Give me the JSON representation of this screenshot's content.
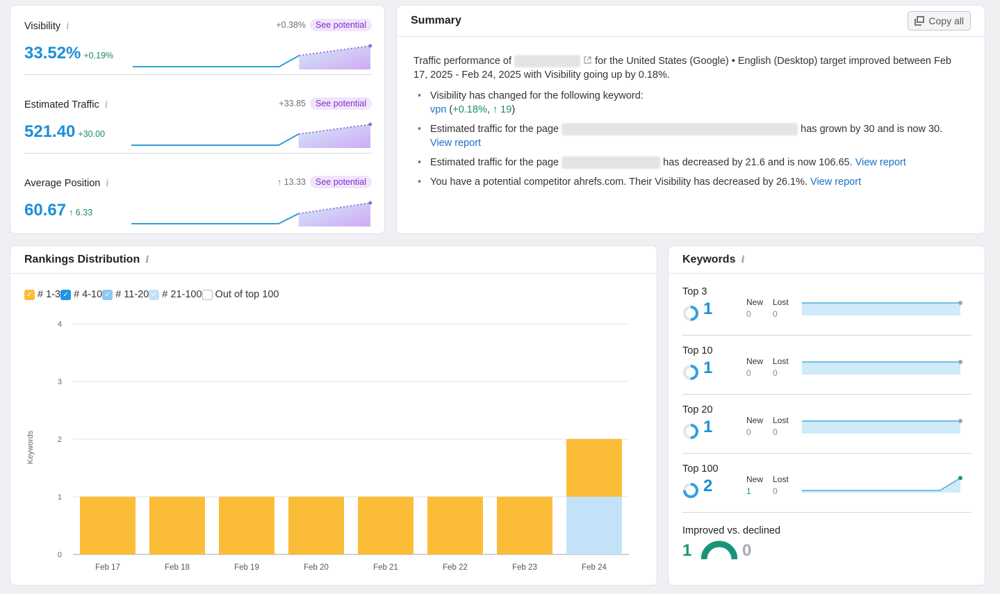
{
  "metrics": [
    {
      "label": "Visibility",
      "value": "33.52%",
      "delta": "+0.19%",
      "potential_delta": "+0.38%",
      "potential_button": "See potential",
      "trend": [
        0,
        0,
        0,
        0,
        0,
        0,
        0,
        1
      ],
      "potential_target": 2
    },
    {
      "label": "Estimated Traffic",
      "value": "521.40",
      "delta": "+30.00",
      "potential_delta": "+33.85",
      "potential_button": "See potential",
      "trend": [
        0,
        0,
        0,
        0,
        0,
        0,
        0,
        1
      ],
      "potential_target": 2
    },
    {
      "label": "Average Position",
      "value": "60.67",
      "delta": "↑ 6.33",
      "potential_delta": "↑ 13.33",
      "potential_button": "See potential",
      "trend": [
        0,
        0,
        0,
        0,
        0,
        0,
        0,
        1
      ],
      "potential_target": 2.2
    }
  ],
  "summary": {
    "title": "Summary",
    "copy_all": "Copy all",
    "intro_prefix": "Traffic performance of",
    "intro_suffix": "for the United States (Google) • English (Desktop) target improved between Feb 17, 2025 - Feb 24, 2025 with Visibility going up by 0.18%.",
    "bullets": {
      "b1_text": "Visibility has changed for the following keyword:",
      "b1_keyword": "vpn",
      "b1_paren_open": " (",
      "b1_change": "+0.18%",
      "b1_comma": ", ",
      "b1_rank": "↑ 19",
      "b1_paren_close": ")",
      "b2_prefix": "Estimated traffic for the page",
      "b2_suffix": "has grown by 30 and is now 30.",
      "b2_link": "View report",
      "b3_prefix": "Estimated traffic for the page",
      "b3_suffix": "has decreased by 21.6 and is now 106.65.",
      "b3_link": "View report",
      "b4_text": "You have a potential competitor ahrefs.com. Their Visibility has decreased by 26.1%.",
      "b4_link": "View report"
    }
  },
  "rankings": {
    "title": "Rankings Distribution",
    "legend": [
      {
        "label": "# 1-3",
        "color": "#fbbd38",
        "checked": true
      },
      {
        "label": "# 4-10",
        "color": "#2196e0",
        "checked": true
      },
      {
        "label": "# 11-20",
        "color": "#8cc9f2",
        "checked": true
      },
      {
        "label": "# 21-100",
        "color": "#c3e2f8",
        "checked": true
      },
      {
        "label": "Out of top 100",
        "color": "#ffffff",
        "checked": false
      }
    ]
  },
  "chart_data": {
    "type": "bar",
    "stacked": true,
    "title": "Rankings Distribution",
    "xlabel": "",
    "ylabel": "Keywords",
    "ylim": [
      0,
      4
    ],
    "yticks": [
      0,
      1,
      2,
      3,
      4
    ],
    "grid": true,
    "legend_position": "top-left",
    "categories": [
      "Feb 17",
      "Feb 18",
      "Feb 19",
      "Feb 20",
      "Feb 21",
      "Feb 22",
      "Feb 23",
      "Feb 24"
    ],
    "series": [
      {
        "name": "# 21-100",
        "color": "#c3e2f8",
        "values": [
          0,
          0,
          0,
          0,
          0,
          0,
          0,
          1
        ]
      },
      {
        "name": "# 1-3",
        "color": "#fbbd38",
        "values": [
          1,
          1,
          1,
          1,
          1,
          1,
          1,
          1
        ]
      },
      {
        "name": "# 4-10",
        "color": "#2196e0",
        "values": [
          0,
          0,
          0,
          0,
          0,
          0,
          0,
          0
        ]
      },
      {
        "name": "# 11-20",
        "color": "#8cc9f2",
        "values": [
          0,
          0,
          0,
          0,
          0,
          0,
          0,
          0
        ]
      }
    ]
  },
  "keywords": {
    "title": "Keywords",
    "new_label": "New",
    "lost_label": "Lost",
    "rows": [
      {
        "label": "Top 3",
        "count": "1",
        "share": 0.5,
        "new": "0",
        "lost": "0",
        "trend": [
          1,
          1,
          1,
          1,
          1,
          1,
          1,
          1
        ]
      },
      {
        "label": "Top 10",
        "count": "1",
        "share": 0.5,
        "new": "0",
        "lost": "0",
        "trend": [
          1,
          1,
          1,
          1,
          1,
          1,
          1,
          1
        ]
      },
      {
        "label": "Top 20",
        "count": "1",
        "share": 0.5,
        "new": "0",
        "lost": "0",
        "trend": [
          1,
          1,
          1,
          1,
          1,
          1,
          1,
          1
        ]
      },
      {
        "label": "Top 100",
        "count": "2",
        "share": 0.75,
        "new": "1",
        "lost": "0",
        "trend": [
          1,
          1,
          1,
          1,
          1,
          1,
          1,
          2
        ]
      }
    ],
    "improved_label": "Improved vs. declined",
    "improved": "1",
    "declined": "0"
  },
  "colors": {
    "accent_blue": "#1a8fd8",
    "green": "#1a9478",
    "purple": "#8330c8",
    "bar_yellow": "#fbbd38",
    "bar_light_blue": "#c3e2f8"
  }
}
